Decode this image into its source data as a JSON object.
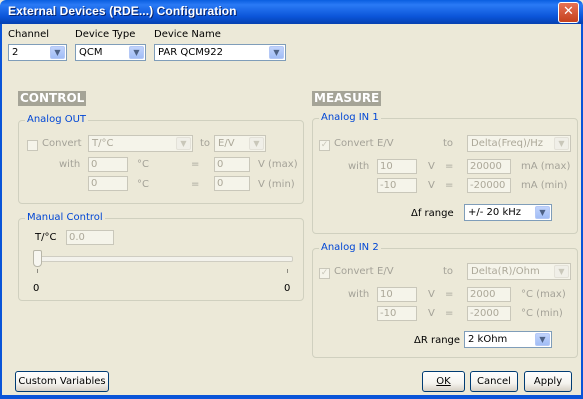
{
  "window": {
    "title": "External Devices (RDE...) Configuration",
    "close_glyph": "✕"
  },
  "top": {
    "channel_label": "Channel",
    "channel_value": "2",
    "device_type_label": "Device Type",
    "device_type_value": "QCM",
    "device_name_label": "Device Name",
    "device_name_value": "PAR QCM922"
  },
  "control": {
    "header": "CONTROL",
    "analog_out": {
      "group_label": "Analog OUT",
      "convert_label": "Convert",
      "from_value": "T/°C",
      "to_label": "to",
      "to_value": "E/V",
      "with_label": "with",
      "row1": {
        "in_value": "0",
        "in_unit": "°C",
        "eq": "=",
        "out_value": "0",
        "out_unit": "V (max)"
      },
      "row2": {
        "in_value": "0",
        "in_unit": "°C",
        "eq": "=",
        "out_value": "0",
        "out_unit": "V (min)"
      }
    },
    "manual": {
      "group_label": "Manual Control",
      "t_label": "T/°C",
      "t_value": "0.0",
      "slider_min": "0",
      "slider_max": "0",
      "slider_position": 0
    }
  },
  "measure": {
    "header": "MEASURE",
    "in1": {
      "group_label": "Analog IN 1",
      "convert_label": "Convert",
      "from_value": "E/V",
      "to_label": "to",
      "to_value": "Delta(Freq)/Hz",
      "with_label": "with",
      "row1": {
        "in_value": "10",
        "in_unit": "V",
        "eq": "=",
        "out_value": "20000",
        "out_unit": "mA (max)"
      },
      "row2": {
        "in_value": "-10",
        "in_unit": "V",
        "eq": "=",
        "out_value": "-20000",
        "out_unit": "mA (min)"
      },
      "range_label": "Δf range",
      "range_value": "+/- 20 kHz"
    },
    "in2": {
      "group_label": "Analog IN 2",
      "convert_label": "Convert",
      "from_value": "E/V",
      "to_label": "to",
      "to_value": "Delta(R)/Ohm",
      "with_label": "with",
      "row1": {
        "in_value": "10",
        "in_unit": "V",
        "eq": "=",
        "out_value": "2000",
        "out_unit": "°C (max)"
      },
      "row2": {
        "in_value": "-10",
        "in_unit": "V",
        "eq": "=",
        "out_value": "-2000",
        "out_unit": "°C (min)"
      },
      "range_label": "ΔR range",
      "range_value": "2 kOhm"
    }
  },
  "buttons": {
    "custom_variables": "Custom Variables",
    "ok": "OK",
    "cancel": "Cancel",
    "apply": "Apply"
  },
  "colors": {
    "title_bar": "#0a54d8",
    "group_label": "#0046d5",
    "dialog_bg": "#ece9d8"
  }
}
